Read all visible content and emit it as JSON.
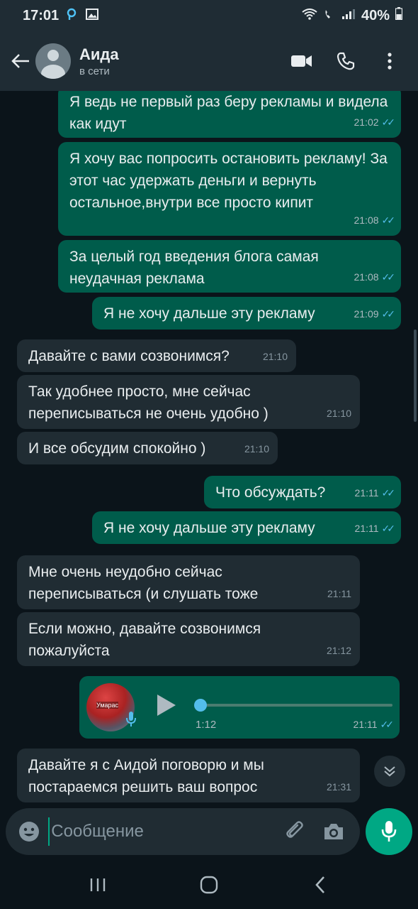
{
  "status_bar": {
    "time": "17:01",
    "battery": "40%"
  },
  "header": {
    "contact_name": "Аида",
    "contact_status": "в сети"
  },
  "messages": [
    {
      "dir": "out",
      "text": "Я ведь не первый раз беру рекламы и видела как идут",
      "time": "21:02"
    },
    {
      "dir": "out",
      "text": "Я хочу вас попросить остановить рекламу! За этот час удержать деньги и вернуть остальное,внутри все просто кипит",
      "time": "21:08"
    },
    {
      "dir": "out",
      "text": "За целый год введения блога самая неудачная реклама",
      "time": "21:08"
    },
    {
      "dir": "out",
      "text": "Я не хочу дальше эту рекламу",
      "time": "21:09"
    },
    {
      "dir": "in",
      "text": "Давайте с вами созвонимся?",
      "time": "21:10"
    },
    {
      "dir": "in",
      "text": "Так удобнее просто, мне сейчас переписываться не очень удобно )",
      "time": "21:10"
    },
    {
      "dir": "in",
      "text": "И все обсудим спокойно )",
      "time": "21:10"
    },
    {
      "dir": "out",
      "text": "Что обсуждать?",
      "time": "21:11"
    },
    {
      "dir": "out",
      "text": "Я не хочу дальше эту рекламу",
      "time": "21:11"
    },
    {
      "dir": "in",
      "text": "Мне очень неудобно сейчас переписываться (и слушать тоже",
      "time": "21:11"
    },
    {
      "dir": "in",
      "text": "Если можно, давайте созвонимся пожалуйста",
      "time": "21:12"
    },
    {
      "dir": "in",
      "text": "Давайте я с Аидой поговорю и мы постараемся решить ваш вопрос",
      "time": "21:31"
    }
  ],
  "voice_message": {
    "duration": "1:12",
    "time": "21:11",
    "progress": 0
  },
  "composer": {
    "placeholder": "Сообщение"
  },
  "colors": {
    "outgoing_bubble": "#005c4b",
    "incoming_bubble": "#202c33",
    "read_ticks": "#53bdeb",
    "accent": "#00a884"
  }
}
